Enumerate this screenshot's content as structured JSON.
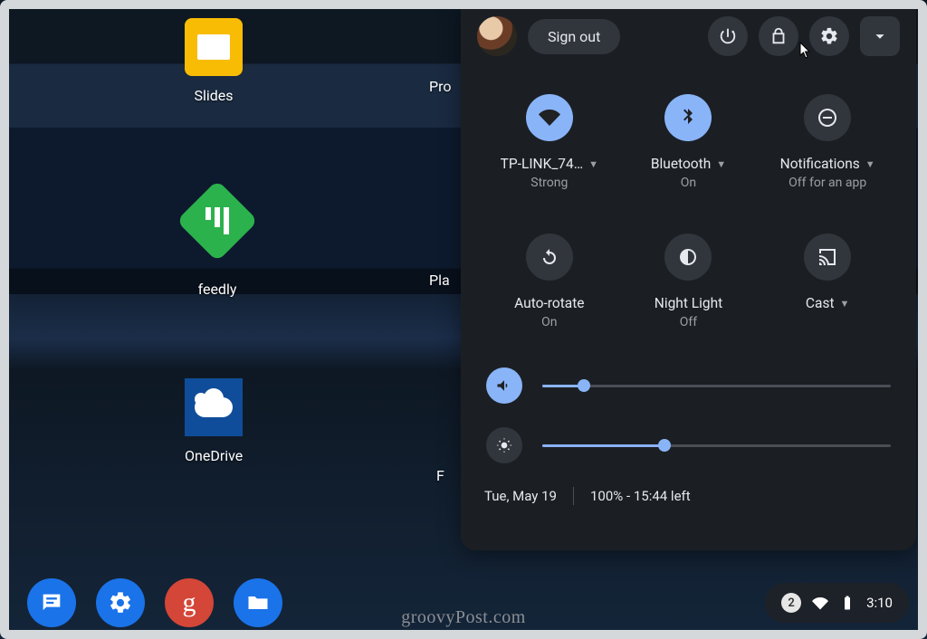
{
  "desktop": {
    "icons": {
      "slides": "Slides",
      "feedly": "feedly",
      "onedrive": "OneDrive",
      "partial1": "Pro",
      "partial2": "Pla",
      "partial3": "F"
    }
  },
  "panel": {
    "signout": "Sign out",
    "tiles": {
      "wifi": {
        "title": "TP-LINK_74…",
        "sub": "Strong"
      },
      "bluetooth": {
        "title": "Bluetooth",
        "sub": "On"
      },
      "notifications": {
        "title": "Notifications",
        "sub": "Off for an app"
      },
      "autorotate": {
        "title": "Auto-rotate",
        "sub": "On"
      },
      "nightlight": {
        "title": "Night Light",
        "sub": "Off"
      },
      "cast": {
        "title": "Cast"
      }
    },
    "sliders": {
      "volume": 12,
      "brightness": 35
    },
    "footer": {
      "date": "Tue, May 19",
      "battery": "100% - 15:44 left"
    }
  },
  "tray": {
    "notification_count": "2",
    "time": "3:10"
  },
  "watermark": "groovyPost.com"
}
